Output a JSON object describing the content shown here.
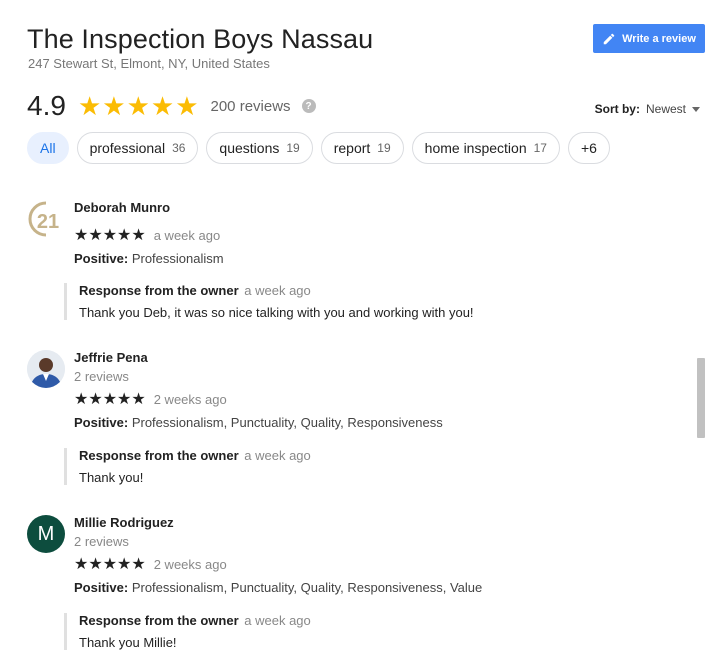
{
  "business": {
    "name": "The Inspection Boys Nassau",
    "address": "247 Stewart St, Elmont, NY, United States"
  },
  "write_review_label": "Write a review",
  "summary": {
    "rating": "4.9",
    "stars": "★★★★★",
    "review_count": "200 reviews",
    "help": "?"
  },
  "sort": {
    "label": "Sort by:",
    "value": "Newest"
  },
  "chips": [
    {
      "label": "All",
      "count": ""
    },
    {
      "label": "professional",
      "count": "36"
    },
    {
      "label": "questions",
      "count": "19"
    },
    {
      "label": "report",
      "count": "19"
    },
    {
      "label": "home inspection",
      "count": "17"
    },
    {
      "label": "+6",
      "count": ""
    }
  ],
  "reviews": [
    {
      "name": "Deborah Munro",
      "sub": "",
      "avatar_text": "21",
      "stars": "★★★★★",
      "time": "a week ago",
      "attr_label": "Positive:",
      "attrs": "Professionalism",
      "response": {
        "label": "Response from the owner",
        "time": "a week ago",
        "text": "Thank you Deb, it was so nice talking with you and working with you!"
      }
    },
    {
      "name": "Jeffrie Pena",
      "sub": "2 reviews",
      "avatar_text": "",
      "stars": "★★★★★",
      "time": "2 weeks ago",
      "attr_label": "Positive:",
      "attrs": "Professionalism, Punctuality, Quality, Responsiveness",
      "response": {
        "label": "Response from the owner",
        "time": "a week ago",
        "text": "Thank you!"
      }
    },
    {
      "name": "Millie Rodriguez",
      "sub": "2 reviews",
      "avatar_text": "M",
      "stars": "★★★★★",
      "time": "2 weeks ago",
      "attr_label": "Positive:",
      "attrs": "Professionalism, Punctuality, Quality, Responsiveness, Value",
      "response": {
        "label": "Response from the owner",
        "time": "a week ago",
        "text": "Thank you Millie!"
      }
    }
  ],
  "colors": {
    "accent": "#4285f4",
    "star": "#fbbc04",
    "chip_active_bg": "#e8f0fe",
    "avatar_m": "#0d4d3e"
  }
}
